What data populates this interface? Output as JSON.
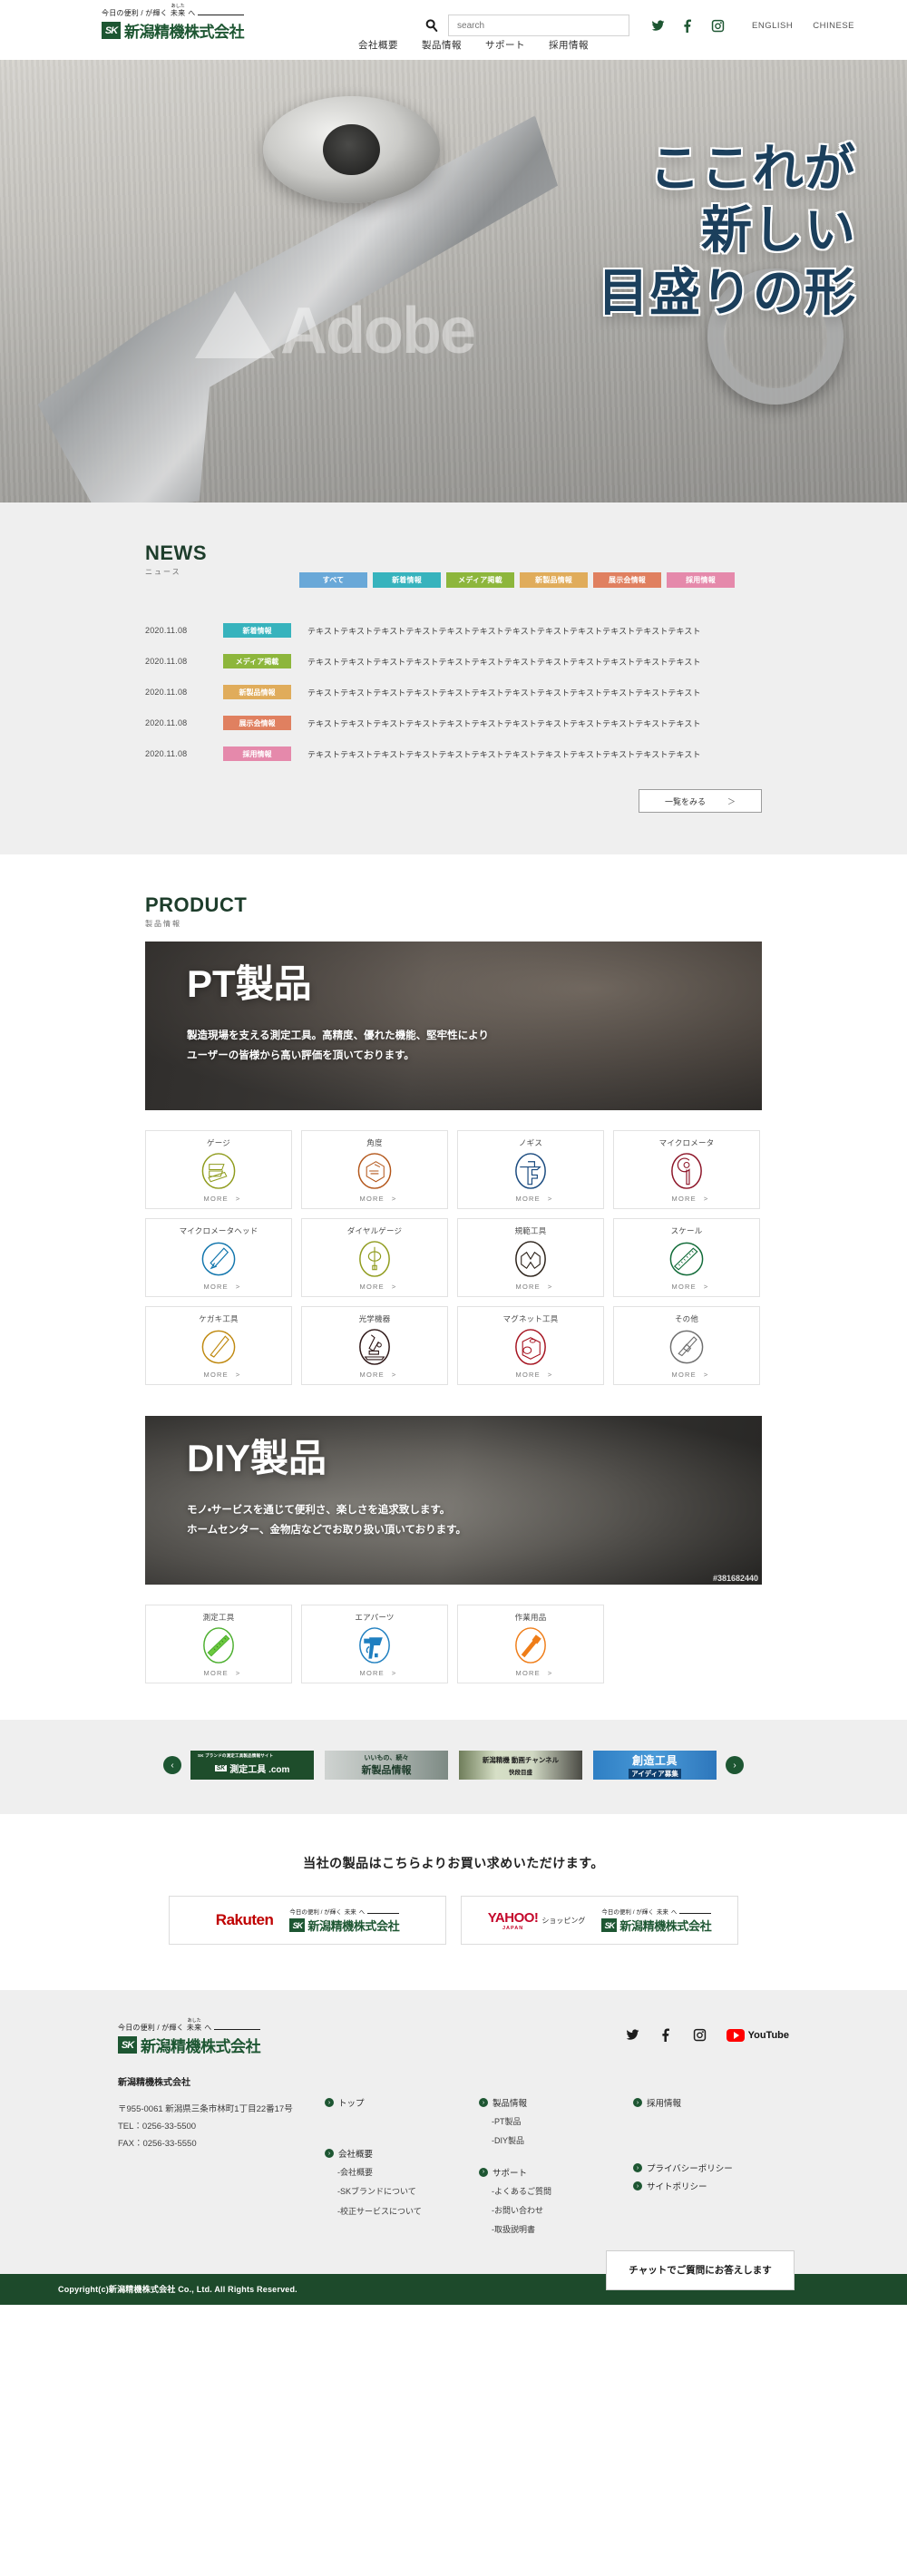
{
  "brand": {
    "tagline_prefix": "今日の便利 / が輝く",
    "tagline_ruby": "未来",
    "tagline_ruby_rt": "あした",
    "tagline_suffix": "へ",
    "mark": "SK",
    "name": "新潟精機株式会社",
    "accent": "#1d5632"
  },
  "header": {
    "search": {
      "placeholder": "search",
      "value": "",
      "icon": "search-icon"
    },
    "social": [
      "twitter-icon",
      "facebook-icon",
      "instagram-icon"
    ],
    "languages": [
      {
        "label": "ENGLISH"
      },
      {
        "label": "CHINESE"
      }
    ],
    "nav": [
      {
        "label": "会社概要"
      },
      {
        "label": "製品情報"
      },
      {
        "label": "サポート"
      },
      {
        "label": "採用情報"
      }
    ]
  },
  "hero": {
    "watermark": "Adobe",
    "headline_lines": [
      "ここれが",
      "新しい",
      "目盛りの形"
    ],
    "headline_color": "#1b3f5c"
  },
  "news": {
    "title_en": "NEWS",
    "title_ja": "ニュース",
    "tabs": [
      {
        "label": "すべて",
        "color": "#69a8d8"
      },
      {
        "label": "新着情報",
        "color": "#37b3bd"
      },
      {
        "label": "メディア掲載",
        "color": "#8db63c"
      },
      {
        "label": "新製品情報",
        "color": "#e0ac5b"
      },
      {
        "label": "展示会情報",
        "color": "#e08060"
      },
      {
        "label": "採用情報",
        "color": "#e589ab"
      }
    ],
    "items": [
      {
        "date": "2020.11.08",
        "category": "新着情報",
        "color": "#37b3bd",
        "text": "テキストテキストテキストテキストテキストテキストテキストテキストテキストテキストテキストテキスト"
      },
      {
        "date": "2020.11.08",
        "category": "メディア掲載",
        "color": "#8db63c",
        "text": "テキストテキストテキストテキストテキストテキストテキストテキストテキストテキストテキストテキスト"
      },
      {
        "date": "2020.11.08",
        "category": "新製品情報",
        "color": "#e0ac5b",
        "text": "テキストテキストテキストテキストテキストテキストテキストテキストテキストテキストテキストテキスト"
      },
      {
        "date": "2020.11.08",
        "category": "展示会情報",
        "color": "#e08060",
        "text": "テキストテキストテキストテキストテキストテキストテキストテキストテキストテキストテキストテキスト"
      },
      {
        "date": "2020.11.08",
        "category": "採用情報",
        "color": "#e589ab",
        "text": "テキストテキストテキストテキストテキストテキストテキストテキストテキストテキストテキストテキスト"
      }
    ],
    "more_label": "一覧をみる",
    "more_arrow": "＞"
  },
  "product": {
    "title_en": "PRODUCT",
    "title_ja": "製品情報",
    "pt_banner": {
      "heading": "PT製品",
      "line1": "製造現場を支える測定工具。高精度、優れた機能、堅牢性により",
      "line2": "ユーザーの皆様から高い評価を頂いております。"
    },
    "pt_cards": [
      {
        "title": "ゲージ",
        "color": "#8f9b1c",
        "icon": "gauge-blocks-icon",
        "more": "MORE"
      },
      {
        "title": "角度",
        "color": "#b3561a",
        "icon": "angle-protractor-icon",
        "more": "MORE"
      },
      {
        "title": "ノギス",
        "color": "#18497e",
        "icon": "caliper-icon",
        "more": "MORE"
      },
      {
        "title": "マイクロメータ",
        "color": "#8c1326",
        "icon": "micrometer-icon",
        "more": "MORE"
      },
      {
        "title": "マイクロメータヘッド",
        "color": "#1276ad",
        "icon": "micrometer-head-icon",
        "more": "MORE"
      },
      {
        "title": "ダイヤルゲージ",
        "color": "#8f9b1c",
        "icon": "dial-gauge-icon",
        "more": "MORE"
      },
      {
        "title": "規範工具",
        "color": "#2b2118",
        "icon": "vee-block-icon",
        "more": "MORE"
      },
      {
        "title": "スケール",
        "color": "#116b38",
        "icon": "scale-ruler-icon",
        "more": "MORE"
      },
      {
        "title": "ケガキ工具",
        "color": "#c08a12",
        "icon": "scriber-icon",
        "more": "MORE"
      },
      {
        "title": "光学機器",
        "color": "#2b1414",
        "icon": "microscope-icon",
        "more": "MORE"
      },
      {
        "title": "マグネット工具",
        "color": "#a5121f",
        "icon": "magnet-block-icon",
        "more": "MORE"
      },
      {
        "title": "その他",
        "color": "#6f6f6f",
        "icon": "other-tool-icon",
        "more": "MORE"
      }
    ],
    "diy_banner": {
      "heading": "DIY製品",
      "line1": "モノ・サービスを通じて便利さ、楽しさを追求致します。",
      "line2": "ホームセンター、金物店などでお取り扱い頂いております。",
      "credit": "#381682440"
    },
    "diy_cards": [
      {
        "title": "測定工具",
        "color": "#4caf2e",
        "icon": "ruler-icon",
        "more": "MORE"
      },
      {
        "title": "エアパーツ",
        "color": "#1f7fc0",
        "icon": "air-gun-icon",
        "more": "MORE"
      },
      {
        "title": "作業用品",
        "color": "#ef7d18",
        "icon": "hammer-icon",
        "more": "MORE"
      }
    ]
  },
  "carousel": {
    "prev_label": "‹",
    "next_label": "›",
    "items": [
      {
        "sub": "SK ブランドの測定工具製品情報サイト",
        "mark": "SK",
        "main": "測定工具 .com",
        "style": "ci1"
      },
      {
        "t1": "いいもの、続々",
        "t2": "新製品情報",
        "style": "ci2"
      },
      {
        "t1": "新潟精機 動画チャンネル",
        "t2": "快段目盛",
        "style": "ci3"
      },
      {
        "t1": "創造工具",
        "t2": "アイディア募集",
        "style": "ci4"
      }
    ]
  },
  "shop": {
    "heading": "当社の製品はこちらよりお買い求めいただけます。",
    "cards": [
      {
        "brand": "Rakuten",
        "sub": "",
        "type": "rakuten"
      },
      {
        "brand": "YAHOO!",
        "brand_jp": "JAPAN",
        "sub": "ショッピング",
        "type": "yahoo"
      }
    ]
  },
  "footer": {
    "company": "新潟精機株式会社",
    "address": "〒955-0061 新潟県三条市林町1丁目22番17号",
    "tel": "TEL：0256-33-5500",
    "fax": "FAX：0256-33-5550",
    "social": [
      "twitter-icon",
      "facebook-icon",
      "instagram-icon"
    ],
    "youtube_label": "YouTube",
    "columns": [
      {
        "groups": [
          {
            "label": "トップ",
            "subs": []
          },
          {
            "label": "会社概要",
            "subs": [
              "-会社概要",
              "-SKブランドについて",
              "-校正サービスについて"
            ]
          }
        ]
      },
      {
        "groups": [
          {
            "label": "製品情報",
            "subs": [
              "-PT製品",
              "-DIY製品"
            ]
          },
          {
            "label": "サポート",
            "subs": [
              "-よくあるご質問",
              "-お問い合わせ",
              "-取扱説明書"
            ]
          }
        ]
      },
      {
        "groups": [
          {
            "label": "採用情報",
            "subs": []
          },
          {
            "label": "プライバシーポリシー",
            "subs": []
          },
          {
            "label": "サイトポリシー",
            "subs": []
          }
        ]
      }
    ],
    "chat_label": "チャットでご質問にお答えします",
    "copyright": "Copyright(c)新潟精機株式会社 Co., Ltd. All Rights Reserved."
  }
}
